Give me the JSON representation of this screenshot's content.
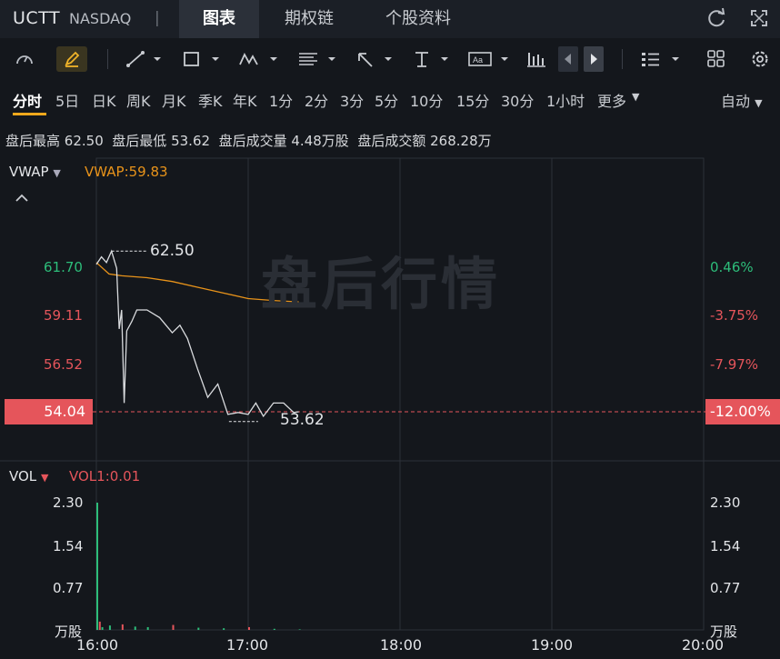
{
  "header": {
    "ticker": "UCTT",
    "exchange": "NASDAQ",
    "separator": "|",
    "tabs": [
      {
        "label": "图表",
        "active": true
      },
      {
        "label": "期权链",
        "active": false
      },
      {
        "label": "个股资料",
        "active": false
      }
    ]
  },
  "toolbar": {
    "icons": [
      "gauge-icon",
      "pen-icon",
      "line-tool-icon",
      "rectangle-tool-icon",
      "pattern-tool-icon",
      "fib-tool-icon",
      "arrow-tool-icon",
      "measure-tool-icon",
      "text-tool-icon",
      "bar-chart-icon",
      "prev-icon",
      "next-icon",
      "list-icon",
      "grid-icon",
      "settings-icon"
    ]
  },
  "periods": [
    "分时",
    "5日",
    "日K",
    "周K",
    "月K",
    "季K",
    "年K",
    "1分",
    "2分",
    "3分",
    "5分",
    "10分",
    "15分",
    "30分",
    "1小时",
    "更多"
  ],
  "period_active": "分时",
  "auto_label": "自动",
  "summary": {
    "high_label": "盘后最高",
    "high_value": "62.50",
    "low_label": "盘后最低",
    "low_value": "53.62",
    "volume_label": "盘后成交量",
    "volume_value": "4.48万股",
    "turnover_label": "盘后成交额",
    "turnover_value": "268.28万"
  },
  "price_panel": {
    "indicator": "VWAP",
    "indicator_value": "VWAP:59.83",
    "watermark": "盘后行情",
    "left_labels": [
      "61.70",
      "59.11",
      "56.52",
      "54.04"
    ],
    "right_labels": [
      "0.46%",
      "-3.75%",
      "-7.97%",
      "-12.00%"
    ],
    "high_marker": "62.50",
    "low_marker": "53.62"
  },
  "volume_panel": {
    "indicator": "VOL",
    "indicator_value": "VOL1:0.01",
    "left_labels": [
      "2.30",
      "1.54",
      "0.77",
      "万股"
    ],
    "right_labels": [
      "2.30",
      "1.54",
      "0.77",
      "万股"
    ]
  },
  "time_axis": [
    "16:00",
    "17:00",
    "18:00",
    "19:00",
    "20:00"
  ],
  "colors": {
    "up": "#2dbd7a",
    "down": "#e5555b",
    "vwap": "#e8931a",
    "price_line": "#d9dbde",
    "background": "#14171c"
  },
  "chart_data": {
    "type": "line",
    "series": [
      {
        "name": "VWAP",
        "x": [
          "16:00",
          "16:05",
          "16:10",
          "16:20",
          "16:30",
          "16:40",
          "16:50",
          "17:00",
          "17:10",
          "17:20"
        ],
        "values": [
          61.9,
          61.3,
          61.2,
          61.1,
          60.9,
          60.6,
          60.3,
          60.0,
          59.9,
          59.83
        ]
      },
      {
        "name": "Price",
        "x": [
          "16:00",
          "16:02",
          "16:04",
          "16:06",
          "16:08",
          "16:09",
          "16:10",
          "16:11",
          "16:12",
          "16:14",
          "16:16",
          "16:20",
          "16:25",
          "16:30",
          "16:33",
          "16:36",
          "16:40",
          "16:44",
          "16:48",
          "16:52",
          "16:56",
          "17:00",
          "17:03",
          "17:06",
          "17:10",
          "17:14",
          "17:18",
          "17:20"
        ],
        "values": [
          61.8,
          62.2,
          61.9,
          62.5,
          61.6,
          58.4,
          59.4,
          54.5,
          58.3,
          58.8,
          59.4,
          59.4,
          59.0,
          58.2,
          58.6,
          57.9,
          56.3,
          54.8,
          55.5,
          53.9,
          54.0,
          53.9,
          54.5,
          53.8,
          54.5,
          54.5,
          54.0,
          54.04
        ]
      }
    ],
    "volume": {
      "x": [
        "16:00",
        "16:01",
        "16:02",
        "16:05",
        "16:10",
        "16:15",
        "16:20",
        "16:30",
        "16:40",
        "16:50",
        "17:00",
        "17:10",
        "17:20"
      ],
      "values": [
        2.3,
        0.15,
        0.05,
        0.08,
        0.1,
        0.06,
        0.05,
        0.09,
        0.04,
        0.03,
        0.05,
        0.02,
        0.01
      ]
    },
    "y_range": [
      52.0,
      64.0
    ],
    "x_range": [
      "16:00",
      "20:00"
    ]
  }
}
